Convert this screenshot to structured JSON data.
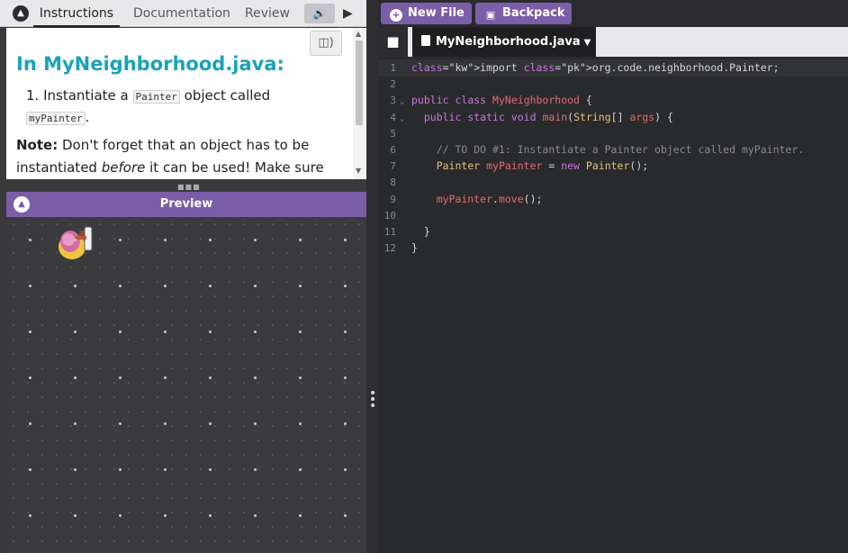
{
  "left_panel": {
    "tabs": [
      "Instructions",
      "Documentation",
      "Review"
    ],
    "active_tab": "Instructions",
    "tts_icon": "speaker-icon",
    "play_icon": "play-icon",
    "read_aloud_icon": "read-aloud-icon",
    "instructions": {
      "title": "In MyNeighborhood.java:",
      "step1_number": "1.",
      "step1_before": "Instantiate a",
      "step1_code": "Painter",
      "step1_middle": "object called",
      "step1_code2": "myPainter",
      "step1_after": ".",
      "note_label": "Note:",
      "note_text_1": "Don't forget that an object has to be instantiated",
      "note_emph": "before",
      "note_text_2": "it can be used! Make sure"
    },
    "preview": {
      "title": "Preview",
      "sprite": "painter-sprite"
    }
  },
  "toolbar": {
    "new_file_label": "New File",
    "backpack_label": "Backpack"
  },
  "file_tab": {
    "filename": "MyNeighborhood.java"
  },
  "code_lines": [
    {
      "n": "1",
      "text": "import org.code.neighborhood.Painter;"
    },
    {
      "n": "2",
      "text": ""
    },
    {
      "n": "3",
      "text": "public class MyNeighborhood {"
    },
    {
      "n": "4",
      "text": "  public static void main(String[] args) {"
    },
    {
      "n": "5",
      "text": ""
    },
    {
      "n": "6",
      "text": "    // TO DO #1: Instantiate a Painter object called myPainter."
    },
    {
      "n": "7",
      "text": "    Painter myPainter = new Painter();"
    },
    {
      "n": "8",
      "text": ""
    },
    {
      "n": "9",
      "text": "    myPainter.move();"
    },
    {
      "n": "10",
      "text": ""
    },
    {
      "n": "11",
      "text": "  }"
    },
    {
      "n": "12",
      "text": "}"
    }
  ],
  "colors": {
    "accent_purple": "#7b5ea8",
    "title_teal": "#1aa3b8",
    "editor_bg": "#292a2c"
  }
}
